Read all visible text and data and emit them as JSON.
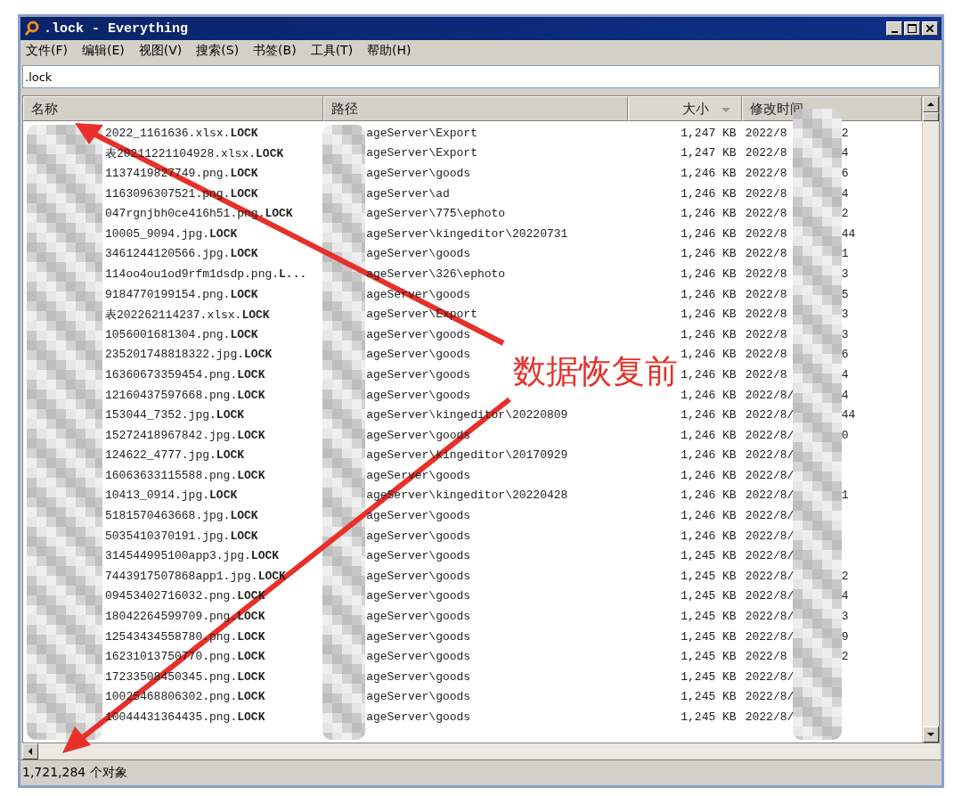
{
  "window": {
    "title": ".lock - Everything"
  },
  "menu": [
    {
      "label": "文件(F)"
    },
    {
      "label": "编辑(E)"
    },
    {
      "label": "视图(V)"
    },
    {
      "label": "搜索(S)"
    },
    {
      "label": "书签(B)"
    },
    {
      "label": "工具(T)"
    },
    {
      "label": "帮助(H)"
    }
  ],
  "search": {
    "value": ".lock"
  },
  "table": {
    "columns": [
      {
        "label": "名称",
        "sorted": false
      },
      {
        "label": "路径",
        "sorted": false
      },
      {
        "label": "大小",
        "sorted": true
      },
      {
        "label": "修改时间",
        "sorted": false
      }
    ],
    "rows": [
      {
        "name": "2022_1161636.xlsx.**LOCK**",
        "path": "ageServer\\Export",
        "size": "1,247 KB",
        "date": "2022/8",
        "date_end": "2"
      },
      {
        "name": "表20211221104928.xlsx.**LOCK**",
        "path": "ageServer\\Export",
        "size": "1,247 KB",
        "date": "2022/8",
        "date_end": "4"
      },
      {
        "name": "1137419827749.png.**LOCK**",
        "path": "ageServer\\goods",
        "size": "1,246 KB",
        "date": "2022/8",
        "date_end": "6"
      },
      {
        "name": "1163096307521.png.**LOCK**",
        "path": "ageServer\\ad",
        "size": "1,246 KB",
        "date": "2022/8",
        "date_end": "4"
      },
      {
        "name": "047rgnjbh0ce416h51.png.**LOCK**",
        "path": "ageServer\\775\\ephoto",
        "size": "1,246 KB",
        "date": "2022/8",
        "date_end": "2"
      },
      {
        "name": "10005_9094.jpg.**LOCK**",
        "path": "ageServer\\kingeditor\\20220731",
        "size": "1,246 KB",
        "date": "2022/8",
        "date_end": "44"
      },
      {
        "name": "3461244120566.jpg.**LOCK**",
        "path": "ageServer\\goods",
        "size": "1,246 KB",
        "date": "2022/8",
        "date_end": "1"
      },
      {
        "name": "114oo4ou1od9rfm1dsdp.png.**L...**",
        "path": "ageServer\\326\\ephoto",
        "size": "1,246 KB",
        "date": "2022/8",
        "date_end": "3"
      },
      {
        "name": "9184770199154.png.**LOCK**",
        "path": "ageServer\\goods",
        "size": "1,246 KB",
        "date": "2022/8",
        "date_end": "5"
      },
      {
        "name": "表202262114237.xlsx.**LOCK**",
        "path": "ageServer\\Export",
        "size": "1,246 KB",
        "date": "2022/8",
        "date_end": "3"
      },
      {
        "name": "1056001681304.png.**LOCK**",
        "path": "ageServer\\goods",
        "size": "1,246 KB",
        "date": "2022/8",
        "date_end": "3"
      },
      {
        "name": "235201748818322.jpg.**LOCK**",
        "path": "ageServer\\goods",
        "size": "1,246 KB",
        "date": "2022/8",
        "date_end": "6"
      },
      {
        "name": "16360673359454.png.**LOCK**",
        "path": "ageServer\\goods",
        "size": "1,246 KB",
        "date": "2022/8",
        "date_end": "4"
      },
      {
        "name": "12160437597668.png.**LOCK**",
        "path": "ageServer\\goods",
        "size": "1,246 KB",
        "date": "2022/8/",
        "date_end": "4"
      },
      {
        "name": "153044_7352.jpg.**LOCK**",
        "path": "ageServer\\kingeditor\\20220809",
        "size": "1,246 KB",
        "date": "2022/8/",
        "date_end": "44"
      },
      {
        "name": "15272418967842.jpg.**LOCK**",
        "path": "ageServer\\goods",
        "size": "1,246 KB",
        "date": "2022/8/",
        "date_end": "0"
      },
      {
        "name": "124622_4777.jpg.**LOCK**",
        "path": "ageServer\\kingeditor\\20170929",
        "size": "1,246 KB",
        "date": "2022/8/"
      },
      {
        "name": "16063633115588.png.**LOCK**",
        "path": "ageServer\\goods",
        "size": "1,246 KB",
        "date": "2022/8/"
      },
      {
        "name": "10413_0914.jpg.**LOCK**",
        "path": "ageServer\\kingeditor\\20220428",
        "size": "1,246 KB",
        "date": "2022/8/",
        "date_end": "1"
      },
      {
        "name": "5181570463668.jpg.**LOCK**",
        "path": "ageServer\\goods",
        "size": "1,246 KB",
        "date": "2022/8/"
      },
      {
        "name": "5035410370191.jpg.**LOCK**",
        "path": "ageServer\\goods",
        "size": "1,246 KB",
        "date": "2022/8/"
      },
      {
        "name": "314544995100app3.jpg.**LOCK**",
        "path": "ageServer\\goods",
        "size": "1,245 KB",
        "date": "2022/8/"
      },
      {
        "name": "7443917507868app1.jpg.**LOCK**",
        "path": "ageServer\\goods",
        "size": "1,245 KB",
        "date": "2022/8/",
        "date_end": "2"
      },
      {
        "name": "09453402716032.png.**LOCK**",
        "path": "ageServer\\goods",
        "size": "1,245 KB",
        "date": "2022/8/",
        "date_end": "4"
      },
      {
        "name": "18042264599709.png.**LOCK**",
        "path": "ageServer\\goods",
        "size": "1,245 KB",
        "date": "2022/8/",
        "date_end": "3"
      },
      {
        "name": "12543434558780.png.**LOCK**",
        "path": "ageServer\\goods",
        "size": "1,245 KB",
        "date": "2022/8/",
        "date_end": "9"
      },
      {
        "name": "16231013750770.png.**LOCK**",
        "path": "ageServer\\goods",
        "size": "1,245 KB",
        "date": "2022/8",
        "date_end": "2"
      },
      {
        "name": "17233508450345.png.**LOCK**",
        "path": "ageServer\\goods",
        "size": "1,245 KB",
        "date": "2022/8/"
      },
      {
        "name": "10025468806302.png.**LOCK**",
        "path": "ageServer\\goods",
        "size": "1,245 KB",
        "date": "2022/8/"
      },
      {
        "name": "10044431364435.png.**LOCK**",
        "path": "ageServer\\goods",
        "size": "1,245 KB",
        "date": "2022/8/"
      }
    ]
  },
  "annotation": {
    "text": "数据恢复前"
  },
  "status_bar": {
    "text": "1,721,284 个对象"
  }
}
